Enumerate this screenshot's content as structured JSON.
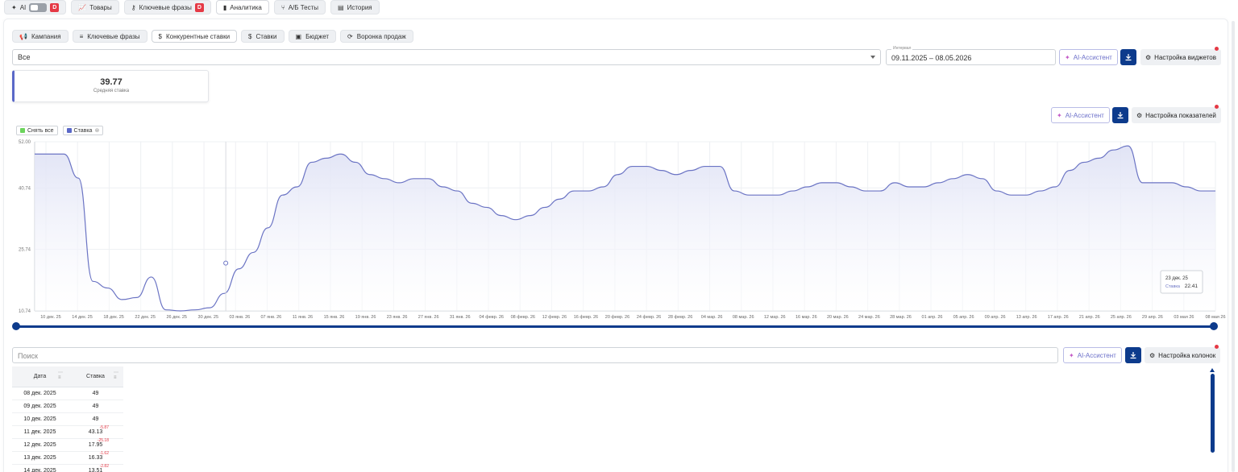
{
  "top_tabs": [
    {
      "label": "AI",
      "icon": "sparkle-icon"
    },
    {
      "label": "Товары",
      "icon": "chart-line-icon"
    },
    {
      "label": "Ключевые фразы",
      "icon": "key-icon"
    },
    {
      "label": "Аналитика",
      "icon": "bar-chart-icon"
    },
    {
      "label": "А/Б Тесты",
      "icon": "ab-test-icon"
    },
    {
      "label": "История",
      "icon": "history-icon"
    }
  ],
  "top_badge": "D",
  "sub_tabs": [
    "Кампания",
    "Ключевые фразы",
    "Конкурентные ставки",
    "Ставки",
    "Бюджет",
    "Воронка продаж"
  ],
  "filter": {
    "value": "Все"
  },
  "date_range": {
    "label": "Интервал",
    "value": "09.11.2025 – 08.05.2026"
  },
  "ai_assistant_label": "AI-Ассистент",
  "widgets_settings_label": "Настройка виджетов",
  "metrics_settings_label": "Настройка показателей",
  "columns_settings_label": "Настройка колонок",
  "kpi": {
    "value": "39.77",
    "label": "Средняя ставка"
  },
  "legend": {
    "clear_all": "Снять все",
    "series": "Ставка"
  },
  "colors": {
    "accent": "#0d3b8c",
    "series": "#6b74c4",
    "series_fill": "#dfe2f5",
    "danger": "#e53945",
    "legend_green": "#6cd45c"
  },
  "tooltip": {
    "date": "23 дек. 25",
    "label": "Ставка",
    "value": "22.41"
  },
  "search": {
    "placeholder": "Поиск"
  },
  "table": {
    "columns": [
      "Дата",
      "Ставка"
    ],
    "rows": [
      {
        "date": "08 дек. 2025",
        "bid": "49",
        "delta": ""
      },
      {
        "date": "09 дек. 2025",
        "bid": "49",
        "delta": ""
      },
      {
        "date": "10 дек. 2025",
        "bid": "49",
        "delta": ""
      },
      {
        "date": "11 дек. 2025",
        "bid": "43.13",
        "delta": "-5.87"
      },
      {
        "date": "12 дек. 2025",
        "bid": "17.95",
        "delta": "-25.18"
      },
      {
        "date": "13 дек. 2025",
        "bid": "16.33",
        "delta": "-1.62"
      },
      {
        "date": "14 дек. 2025",
        "bid": "13.51",
        "delta": "-2.82"
      }
    ]
  },
  "chart_data": {
    "type": "area",
    "series": [
      {
        "name": "Ставка",
        "values": [
          49,
          49,
          49,
          43.13,
          17.95,
          16.33,
          13.51,
          14,
          19,
          11,
          10.74,
          11,
          11.5,
          15,
          21,
          25,
          31,
          39,
          41,
          47,
          48,
          49,
          47,
          44,
          43,
          42,
          43,
          43,
          41,
          40,
          37,
          36,
          34,
          33,
          34,
          36,
          38,
          40,
          40,
          41,
          44,
          46,
          46,
          45,
          44,
          45,
          46,
          46,
          40,
          39,
          39,
          39,
          40,
          41,
          42,
          42,
          41,
          40,
          40,
          42,
          41,
          41,
          42,
          43,
          44,
          43,
          40,
          39,
          39,
          40,
          41,
          45,
          47,
          48,
          50,
          51,
          42,
          42,
          42,
          41,
          40,
          40
        ]
      }
    ],
    "yticks": [
      "52.00",
      "40.74",
      "25.74",
      "10.74"
    ],
    "ylim": [
      10.74,
      52
    ],
    "xticks": [
      "10 дек. 25",
      "14 дек. 25",
      "18 дек. 25",
      "22 дек. 25",
      "26 дек. 25",
      "30 дек. 25",
      "03 янв. 26",
      "07 янв. 26",
      "11 янв. 26",
      "15 янв. 26",
      "19 янв. 26",
      "23 янв. 26",
      "27 янв. 26",
      "31 янв. 26",
      "04 февр. 26",
      "08 февр. 26",
      "12 февр. 26",
      "16 февр. 26",
      "20 февр. 26",
      "24 февр. 26",
      "28 февр. 26",
      "04 мар. 26",
      "08 мар. 26",
      "12 мар. 26",
      "16 мар. 26",
      "20 мар. 26",
      "24 мар. 26",
      "28 мар. 26",
      "01 апр. 26",
      "05 апр. 26",
      "09 апр. 26",
      "13 апр. 26",
      "17 апр. 26",
      "21 апр. 26",
      "25 апр. 26",
      "29 апр. 26",
      "03 мая 26",
      "08 мая 26"
    ]
  }
}
